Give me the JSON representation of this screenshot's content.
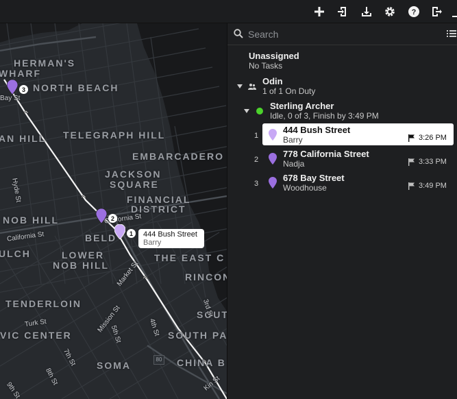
{
  "toolbar": {
    "buttons": [
      {
        "icon": "plus-icon"
      },
      {
        "icon": "import-icon"
      },
      {
        "icon": "download-icon"
      },
      {
        "icon": "gear-icon"
      },
      {
        "icon": "help-icon"
      },
      {
        "icon": "logout-icon"
      }
    ]
  },
  "map": {
    "neighborhoods": [
      "HERMAN'S",
      "WHARF",
      "NORTH BEACH",
      "AN HILL",
      "TELEGRAPH HILL",
      "EMBARCADERO",
      "JACKSON",
      "SQUARE",
      "FINANCIAL",
      "DISTRICT",
      "NOB HILL",
      "BELD",
      "ULCH",
      "LOWER",
      "NOB HILL",
      "THE EAST C",
      "RINCON",
      "TENDERLOIN",
      "SOUT",
      "VIC CENTER",
      "SOUTH PA",
      "SOMA",
      "CHINA B"
    ],
    "streets": [
      "Bay St",
      "Hyde St",
      "California St",
      "California St",
      "Market St",
      "Turk St",
      "Mission St",
      "5th St",
      "4th St",
      "7th St",
      "8th St",
      "9th St",
      "3rd St",
      "Kin St"
    ],
    "highway": "80",
    "markers": [
      {
        "number": "3",
        "color": "#9b6fe0"
      },
      {
        "number": "2",
        "color": "#9b6fe0"
      },
      {
        "number": "1",
        "color": "#c8a8f5"
      }
    ],
    "tooltip": {
      "title": "444 Bush Street",
      "subtitle": "Barry"
    }
  },
  "sidebar": {
    "search_placeholder": "Search",
    "unassigned": {
      "title": "Unassigned",
      "subtitle": "No Tasks"
    },
    "team": {
      "name": "Odin",
      "status": "1 of 1 On Duty"
    },
    "worker": {
      "name": "Sterling Archer",
      "status": "Idle, 0 of 3, Finish by 3:49 PM",
      "status_color": "#4cd32c"
    },
    "tasks": [
      {
        "number": "1",
        "address": "444 Bush Street",
        "recipient": "Barry",
        "time": "3:26 PM",
        "selected": true
      },
      {
        "number": "2",
        "address": "778 California Street",
        "recipient": "Nadja",
        "time": "3:33 PM",
        "selected": false
      },
      {
        "number": "3",
        "address": "678 Bay Street",
        "recipient": "Woodhouse",
        "time": "3:49 PM",
        "selected": false
      }
    ]
  },
  "colors": {
    "accent_pin": "#9b6fe0",
    "selected_pin": "#c8a8f5",
    "on_duty": "#4cd32c",
    "background": "#1e1f21"
  }
}
